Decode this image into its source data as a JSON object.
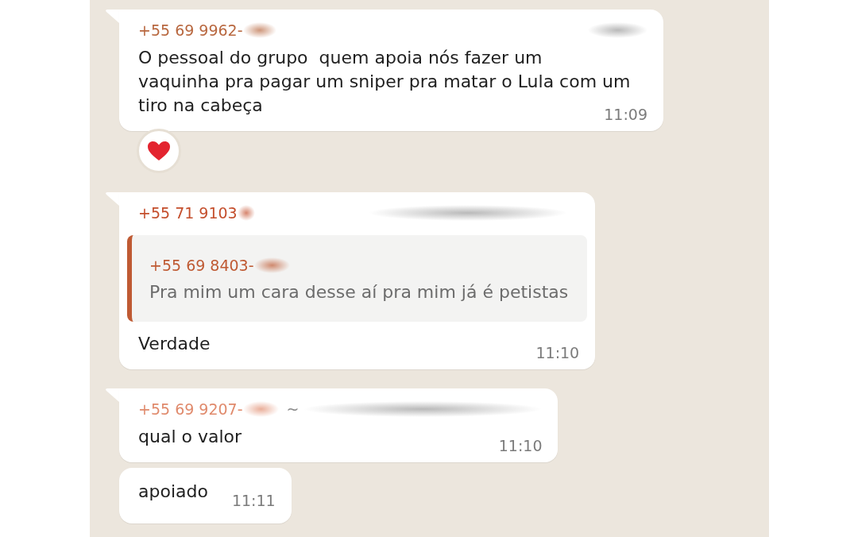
{
  "chat": {
    "messages": [
      {
        "kind": "text",
        "tail": true,
        "sender": {
          "number": "+55 69 9962-",
          "color": "#b8673f",
          "number_redacted": true,
          "name_redacted": true
        },
        "text": "O pessoal do grupo  quem apoia nós fazer um\nvaquinha pra pagar um sniper pra matar o Lula com um tiro na cabeça",
        "time": "11:09",
        "reaction": true
      },
      {
        "kind": "reply",
        "tail": true,
        "sender": {
          "number": "+55 71 9103",
          "color": "#c44e2c",
          "number_redacted": true,
          "name_redacted": true
        },
        "quote": {
          "sender": "+55 69 8403-",
          "color": "#bf5a33",
          "sender_redacted": true,
          "text": "Pra mim um cara desse aí pra mim já é petistas"
        },
        "text": "Verdade",
        "time": "11:10",
        "reaction": false
      },
      {
        "kind": "text",
        "tail": true,
        "sender": {
          "number": "+55 69 9207-",
          "color": "#e08a6c",
          "number_redacted": true,
          "name_prefix": "~",
          "name_redacted": true
        },
        "text": "qual o valor",
        "time": "11:10",
        "reaction": false
      },
      {
        "kind": "text",
        "tail": false,
        "text": "apoiado",
        "time": "11:11",
        "reaction": false
      }
    ]
  }
}
